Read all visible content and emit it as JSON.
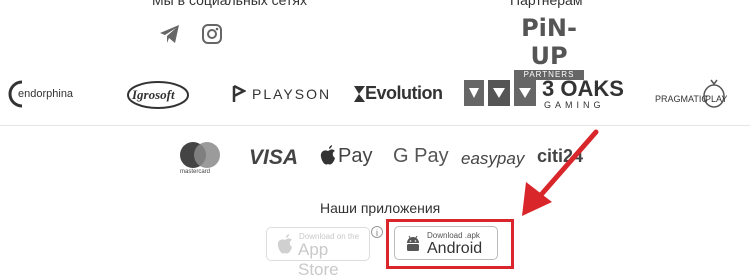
{
  "footer": {
    "social_title": "Мы в социальных сетях",
    "partners_title": "Партнерам",
    "partner_logo": {
      "main": "PiN-UP",
      "sub": "PARTNERS"
    }
  },
  "providers": {
    "endorphina": "endorphina",
    "igrosoft": "Igrosoft",
    "playson": "PLAYSON",
    "evolution": "Evolution",
    "threeoaks_main": "3 OAKS",
    "threeoaks_sub": "GAMING",
    "pragmatic": "PRAGMATIC",
    "pragmatic_play": "PLAY"
  },
  "payments": {
    "mastercard": "mastercard",
    "visa": "VISA",
    "applepay": "Pay",
    "gpay": "G Pay",
    "easypay": "easypay",
    "citi": "citi24"
  },
  "apps": {
    "title": "Наши приложения",
    "appstore_small": "Download on the",
    "appstore_big": "App Store",
    "android_small": "Download .apk",
    "android_big": "Android",
    "info": "i"
  },
  "colors": {
    "highlight": "#d9262b",
    "arrow": "#d9262b"
  }
}
